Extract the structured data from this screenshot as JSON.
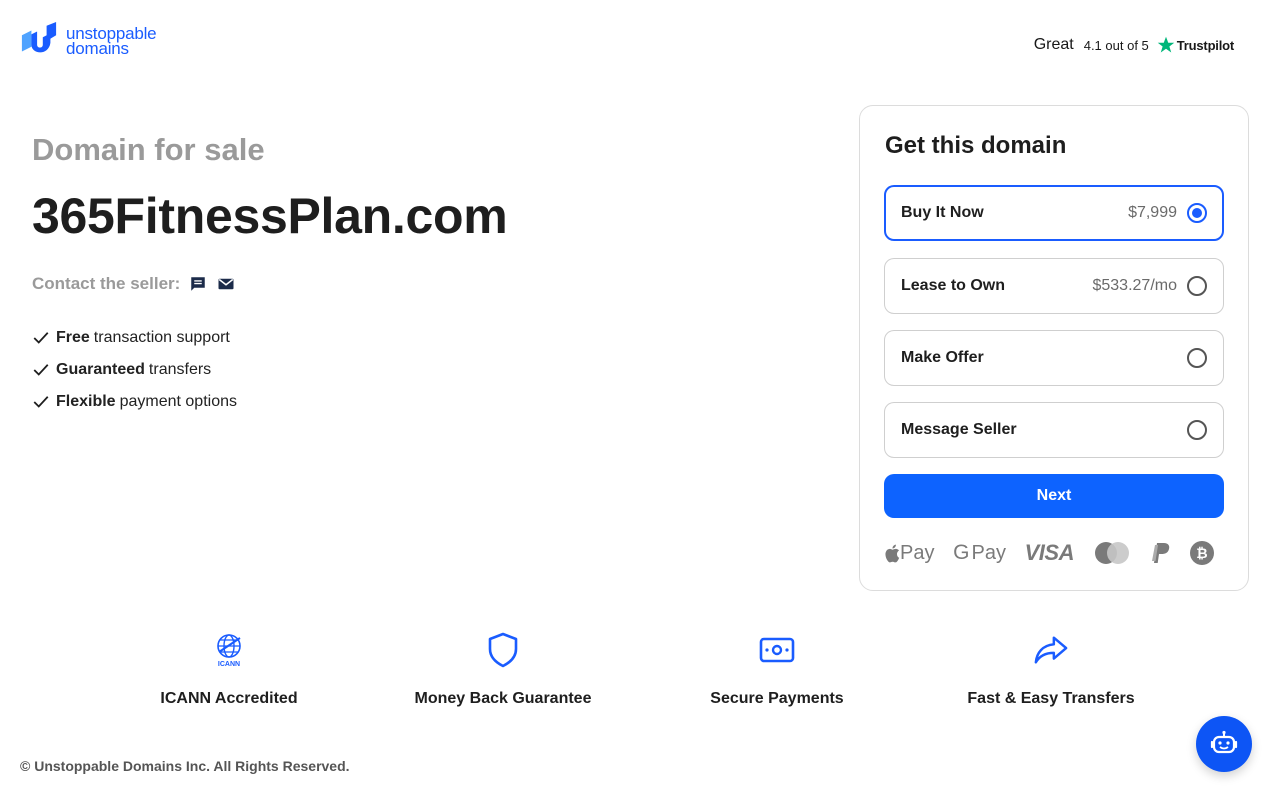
{
  "header": {
    "logo_line1": "unstoppable",
    "logo_line2": "domains",
    "rating_word": "Great",
    "rating_text": "4.1 out of 5",
    "trustpilot_label": "Trustpilot"
  },
  "listing": {
    "subtitle": "Domain for sale",
    "domain": "365FitnessPlan.com",
    "contact_label": "Contact the seller:",
    "contact_icons": [
      "chat-icon",
      "mail-icon"
    ],
    "features": [
      {
        "bold": "Free",
        "rest": "transaction support"
      },
      {
        "bold": "Guaranteed",
        "rest": "transfers"
      },
      {
        "bold": "Flexible",
        "rest": "payment options"
      }
    ]
  },
  "card": {
    "title": "Get this domain",
    "options": [
      {
        "label": "Buy It Now",
        "price": "$7,999",
        "selected": true
      },
      {
        "label": "Lease to Own",
        "price": "$533.27/mo",
        "selected": false
      },
      {
        "label": "Make Offer",
        "price": "",
        "selected": false
      },
      {
        "label": "Message Seller",
        "price": "",
        "selected": false
      }
    ],
    "next_label": "Next",
    "payment_methods": {
      "apple_pay": "Pay",
      "google_pay": "Pay",
      "visa": "VISA",
      "icons": [
        "apple-pay-icon",
        "google-pay-icon",
        "visa-icon",
        "mastercard-icon",
        "paypal-icon",
        "bitcoin-icon"
      ]
    }
  },
  "badges": [
    {
      "label": "ICANN Accredited",
      "icon": "icann-icon"
    },
    {
      "label": "Money Back Guarantee",
      "icon": "shield-icon"
    },
    {
      "label": "Secure Payments",
      "icon": "payment-icon"
    },
    {
      "label": "Fast & Easy Transfers",
      "icon": "share-arrow-icon"
    }
  ],
  "icann_text": "ICANN",
  "footer": {
    "copyright": "© Unstoppable Domains Inc. All Rights Reserved."
  },
  "colors": {
    "brand_blue": "#0d63ff",
    "muted_gray": "#9a9a9a",
    "trustpilot_green": "#00b67a"
  }
}
